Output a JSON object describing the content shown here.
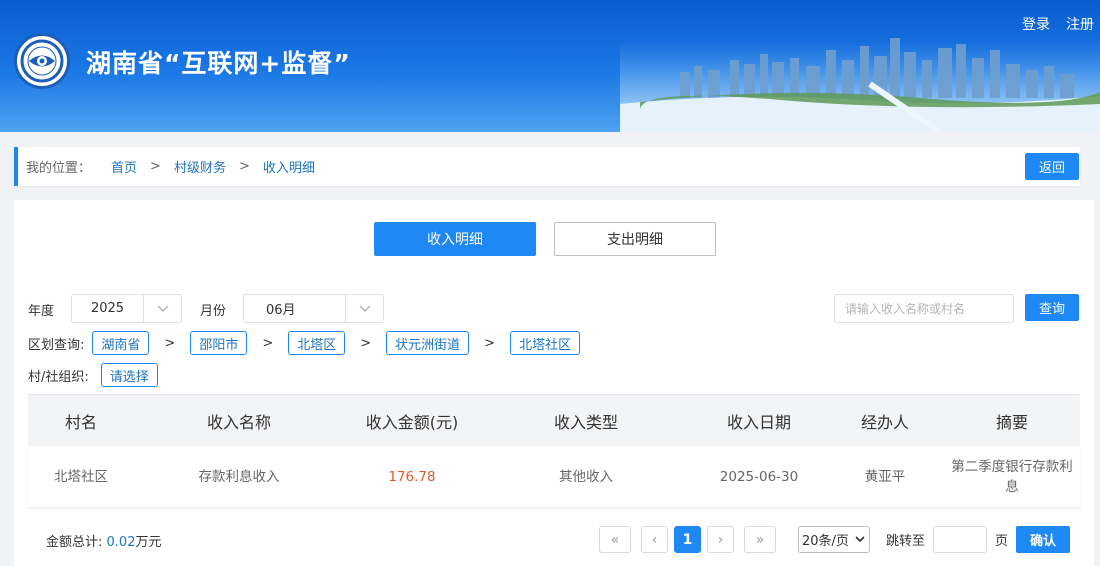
{
  "header": {
    "site_title": "湖南省“互联网+监督”",
    "login": "登录",
    "register": "注册",
    "logo_icon": "eye-seal-icon"
  },
  "breadcrumb": {
    "label": "我的位置：",
    "items": [
      "首页",
      "村级财务",
      "收入明细"
    ],
    "separator": ">",
    "back_label": "返回"
  },
  "tabs": {
    "income": "收入明细",
    "expense": "支出明细",
    "active": "income"
  },
  "filters": {
    "year_label": "年度",
    "year_value": "2025",
    "month_label": "月份",
    "month_value": "06月",
    "search_placeholder": "请输入收入名称或村名",
    "search_value": "",
    "query_label": "查询",
    "region_label": "区划查询:",
    "regions": [
      "湖南省",
      "邵阳市",
      "北塔区",
      "状元洲街道",
      "北塔社区"
    ],
    "region_separator": ">",
    "org_label": "村/社组织:",
    "org_select": "请选择"
  },
  "table": {
    "headers": [
      "村名",
      "收入名称",
      "收入金额(元)",
      "收入类型",
      "收入日期",
      "经办人",
      "摘要"
    ],
    "rows": [
      [
        "北塔社区",
        "存款利息收入",
        "176.78",
        "其他收入",
        "2025-06-30",
        "黄亚平",
        "第二季度银行存款利息"
      ]
    ]
  },
  "summary": {
    "label": "金额总计:",
    "value": "0.02",
    "unit": "万元"
  },
  "pagination": {
    "first": "«",
    "prev": "‹",
    "current": "1",
    "next": "›",
    "last": "»",
    "per_page": "20条/页",
    "jump_label": "跳转至",
    "jump_value": "",
    "page_unit": "页",
    "confirm_label": "确认"
  },
  "colors": {
    "primary": "#1e88f5",
    "link": "#1e73be",
    "amount": "#e8572c",
    "header_top": "#0a5bd0"
  }
}
